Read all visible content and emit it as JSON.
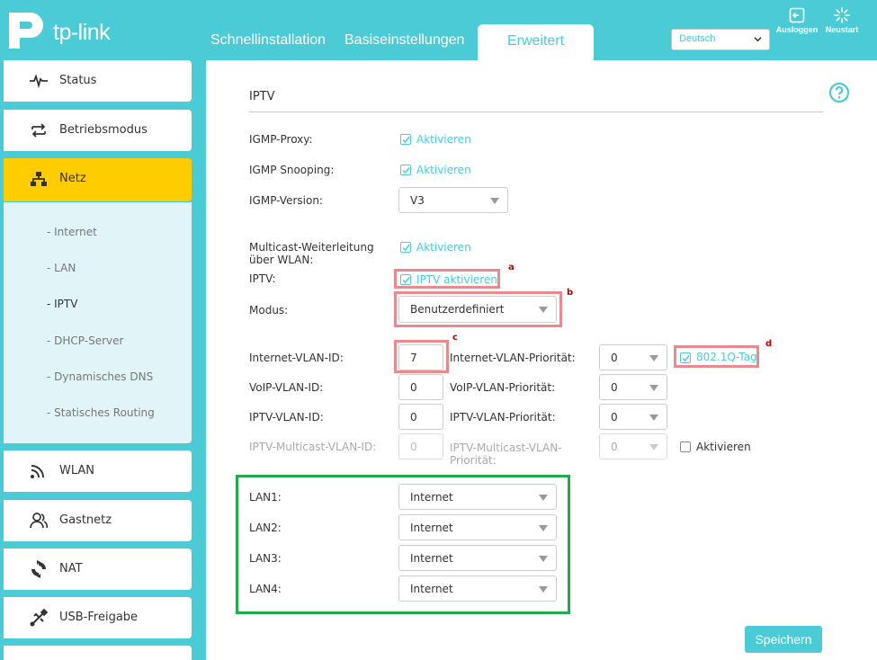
{
  "brand": {
    "logo_text": "tp-link",
    "accent": "#4acbd6",
    "active_color": "#ffcc00",
    "annotation_red": "#e98a8e",
    "annotation_green": "#1faa4b"
  },
  "nav": {
    "tabs": [
      {
        "label": "Schnellinstallation"
      },
      {
        "label": "Basiseinstellungen"
      },
      {
        "label": "Erweitert"
      }
    ],
    "language": "Deutsch",
    "logout_label": "Ausloggen",
    "reboot_label": "Neustart"
  },
  "sidebar": {
    "items": [
      {
        "label": "Status",
        "icon": "pulse-icon"
      },
      {
        "label": "Betriebsmodus",
        "icon": "swap-arrows-icon"
      },
      {
        "label": "Netz",
        "icon": "network-icon"
      },
      {
        "label": "WLAN",
        "icon": "wifi-icon"
      },
      {
        "label": "Gastnetz",
        "icon": "guests-icon"
      },
      {
        "label": "NAT",
        "icon": "nat-icon"
      },
      {
        "label": "USB-Freigabe",
        "icon": "usb-icon"
      }
    ],
    "sub_items": [
      {
        "label": "- Internet"
      },
      {
        "label": "- LAN"
      },
      {
        "label": "- IPTV"
      },
      {
        "label": "- DHCP-Server"
      },
      {
        "label": "- Dynamisches DNS"
      },
      {
        "label": "- Statisches Routing"
      }
    ]
  },
  "main": {
    "title": "IPTV",
    "igmp_proxy": {
      "label": "IGMP-Proxy:",
      "checkbox": "Aktivieren"
    },
    "igmp_snooping": {
      "label": "IGMP Snooping:",
      "checkbox": "Aktivieren"
    },
    "igmp_version": {
      "label": "IGMP-Version:",
      "value": "V3"
    },
    "multicast_wlan": {
      "label_line1": "Multicast-Weiterleitung",
      "label_line2": "über WLAN:",
      "checkbox": "Aktivieren"
    },
    "iptv": {
      "label": "IPTV:",
      "checkbox": "IPTV aktivieren"
    },
    "mode": {
      "label": "Modus:",
      "value": "Benutzerdefiniert"
    },
    "internet_vlan": {
      "label": "Internet-VLAN-ID:",
      "value": "7",
      "prio_label": "Internet-VLAN-Priorität:",
      "prio": "0",
      "tag_label": "802.1Q-Tag"
    },
    "voip_vlan": {
      "label": "VoIP-VLAN-ID:",
      "value": "0",
      "prio_label": "VoIP-VLAN-Priorität:",
      "prio": "0"
    },
    "iptv_vlan": {
      "label": "IPTV-VLAN-ID:",
      "value": "0",
      "prio_label": "IPTV-VLAN-Priorität:",
      "prio": "0"
    },
    "iptv_mc_vlan": {
      "label": "IPTV-Multicast-VLAN-ID:",
      "value": "0",
      "prio_label_line1": "IPTV-Multicast-VLAN-",
      "prio_label_line2": "Priorität:",
      "prio": "0",
      "enable_label": "Aktivieren"
    },
    "lan_ports": [
      {
        "label": "LAN1:",
        "value": "Internet"
      },
      {
        "label": "LAN2:",
        "value": "Internet"
      },
      {
        "label": "LAN3:",
        "value": "Internet"
      },
      {
        "label": "LAN4:",
        "value": "Internet"
      }
    ],
    "annotations": {
      "a": "a",
      "b": "b",
      "c": "c",
      "d": "d"
    },
    "save_label": "Speichern"
  }
}
